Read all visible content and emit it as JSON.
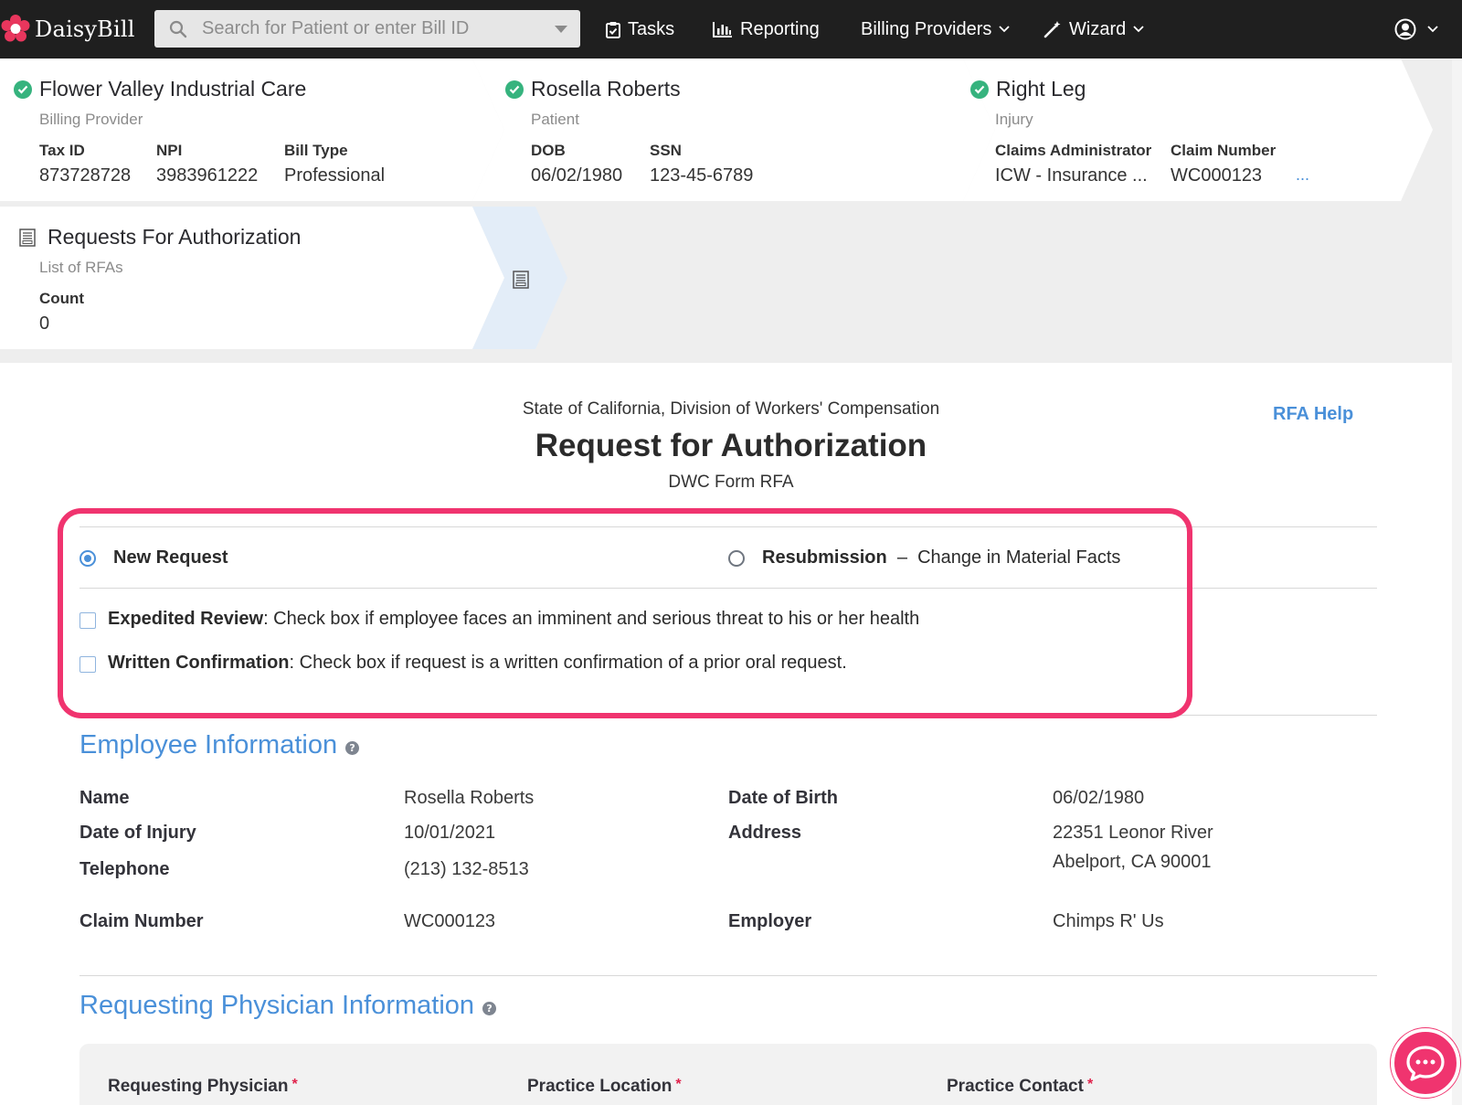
{
  "app": {
    "name": "DaisyBill"
  },
  "colors": {
    "accent": "#4a90d9",
    "highlight": "#f0346f",
    "success": "#36b37e",
    "nav_bg": "#1f1f1f"
  },
  "nav": {
    "search_placeholder": "Search for Patient or enter Bill ID",
    "tasks": "Tasks",
    "reporting": "Reporting",
    "billing_providers": "Billing Providers",
    "wizard": "Wizard"
  },
  "header": {
    "provider": {
      "name": "Flower Valley Industrial Care",
      "type": "Billing Provider",
      "tax_id_label": "Tax ID",
      "tax_id": "873728728",
      "npi_label": "NPI",
      "npi": "3983961222",
      "bill_type_label": "Bill Type",
      "bill_type": "Professional"
    },
    "patient": {
      "name": "Rosella Roberts",
      "type": "Patient",
      "dob_label": "DOB",
      "dob": "06/02/1980",
      "ssn_label": "SSN",
      "ssn": "123-45-6789"
    },
    "injury": {
      "name": "Right Leg",
      "type": "Injury",
      "admin_label": "Claims Administrator",
      "admin": "ICW - Insurance ...",
      "claim_label": "Claim Number",
      "claim": "WC000123",
      "more": "..."
    },
    "rfa": {
      "title": "Requests For Authorization",
      "sub": "List of RFAs",
      "count_label": "Count",
      "count": "0"
    }
  },
  "form": {
    "state": "State of California, Division of Workers' Compensation",
    "title": "Request for Authorization",
    "subtitle": "DWC Form RFA",
    "help": "RFA Help",
    "new_request": "New Request",
    "resubmission": "Resubmission",
    "resubmission_dash": "–",
    "resubmission_detail": "Change in Material Facts",
    "expedited_bold": "Expedited Review",
    "expedited_text": ": Check box if employee faces an imminent and serious threat to his or her health",
    "written_bold": "Written Confirmation",
    "written_text": ": Check box if request is a written confirmation of a prior oral request."
  },
  "employee": {
    "heading": "Employee Information",
    "name_label": "Name",
    "name": "Rosella Roberts",
    "doi_label": "Date of Injury",
    "doi": "10/01/2021",
    "phone_label": "Telephone",
    "phone": "(213) 132-8513",
    "claim_label": "Claim Number",
    "claim": "WC000123",
    "dob_label": "Date of Birth",
    "dob": "06/02/1980",
    "address_label": "Address",
    "address_line1": "22351 Leonor River",
    "address_line2": "Abelport, CA 90001",
    "employer_label": "Employer",
    "employer": "Chimps R' Us"
  },
  "physician": {
    "heading": "Requesting Physician Information",
    "physician_label": "Requesting Physician",
    "location_label": "Practice Location",
    "contact_label": "Practice Contact",
    "required_mark": "*"
  }
}
